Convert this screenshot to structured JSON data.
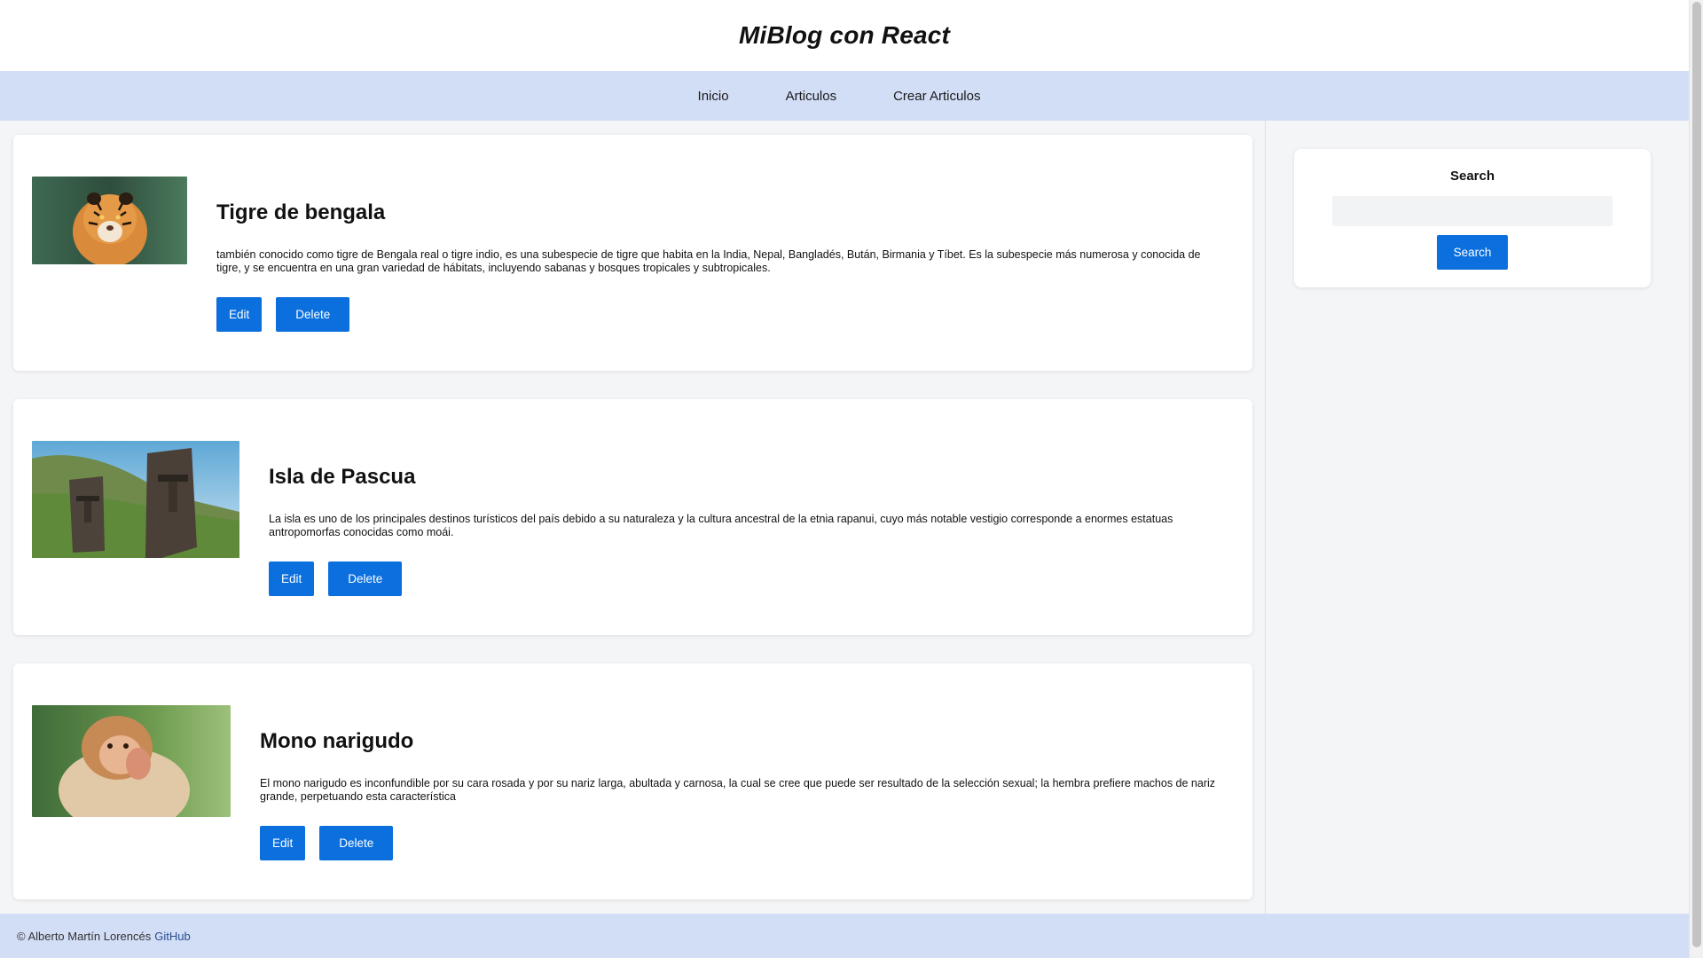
{
  "header": {
    "title": "MiBlog con React"
  },
  "nav": {
    "items": [
      {
        "label": "Inicio"
      },
      {
        "label": "Articulos"
      },
      {
        "label": "Crear Articulos"
      }
    ]
  },
  "articles": [
    {
      "title": "Tigre de bengala",
      "description": "también conocido como tigre de Bengala real o tigre indio, es una subespecie de tigre que habita en la India, Nepal, Bangladés, Bután, Birmania y Tíbet. Es la subespecie más numerosa y conocida de tigre, y se encuentra en una gran variedad de hábitats, incluyendo sabanas y bosques tropicales y subtropicales.",
      "edit_label": "Edit",
      "delete_label": "Delete"
    },
    {
      "title": "Isla de Pascua",
      "description": "La isla es uno de los principales destinos turísticos del país debido a su naturaleza y la cultura ancestral de la etnia rapanui, cuyo más notable vestigio corresponde a enormes estatuas antropomorfas conocidas como moái.",
      "edit_label": "Edit",
      "delete_label": "Delete"
    },
    {
      "title": "Mono narigudo",
      "description": "El mono narigudo es inconfundible por su cara rosada y por su nariz larga, abultada y carnosa, la cual se cree que puede ser resultado de la selección sexual; la hembra prefiere machos de nariz grande, perpetuando esta característica",
      "edit_label": "Edit",
      "delete_label": "Delete"
    }
  ],
  "sidebar": {
    "search": {
      "title": "Search",
      "value": "",
      "placeholder": "",
      "button_label": "Search"
    }
  },
  "footer": {
    "copyright": "© Alberto Martín Lorencés",
    "link_label": "GitHub"
  },
  "colors": {
    "nav_background": "#d2ddf6",
    "button_blue": "#0b6fde",
    "page_background": "#f4f5f7"
  }
}
